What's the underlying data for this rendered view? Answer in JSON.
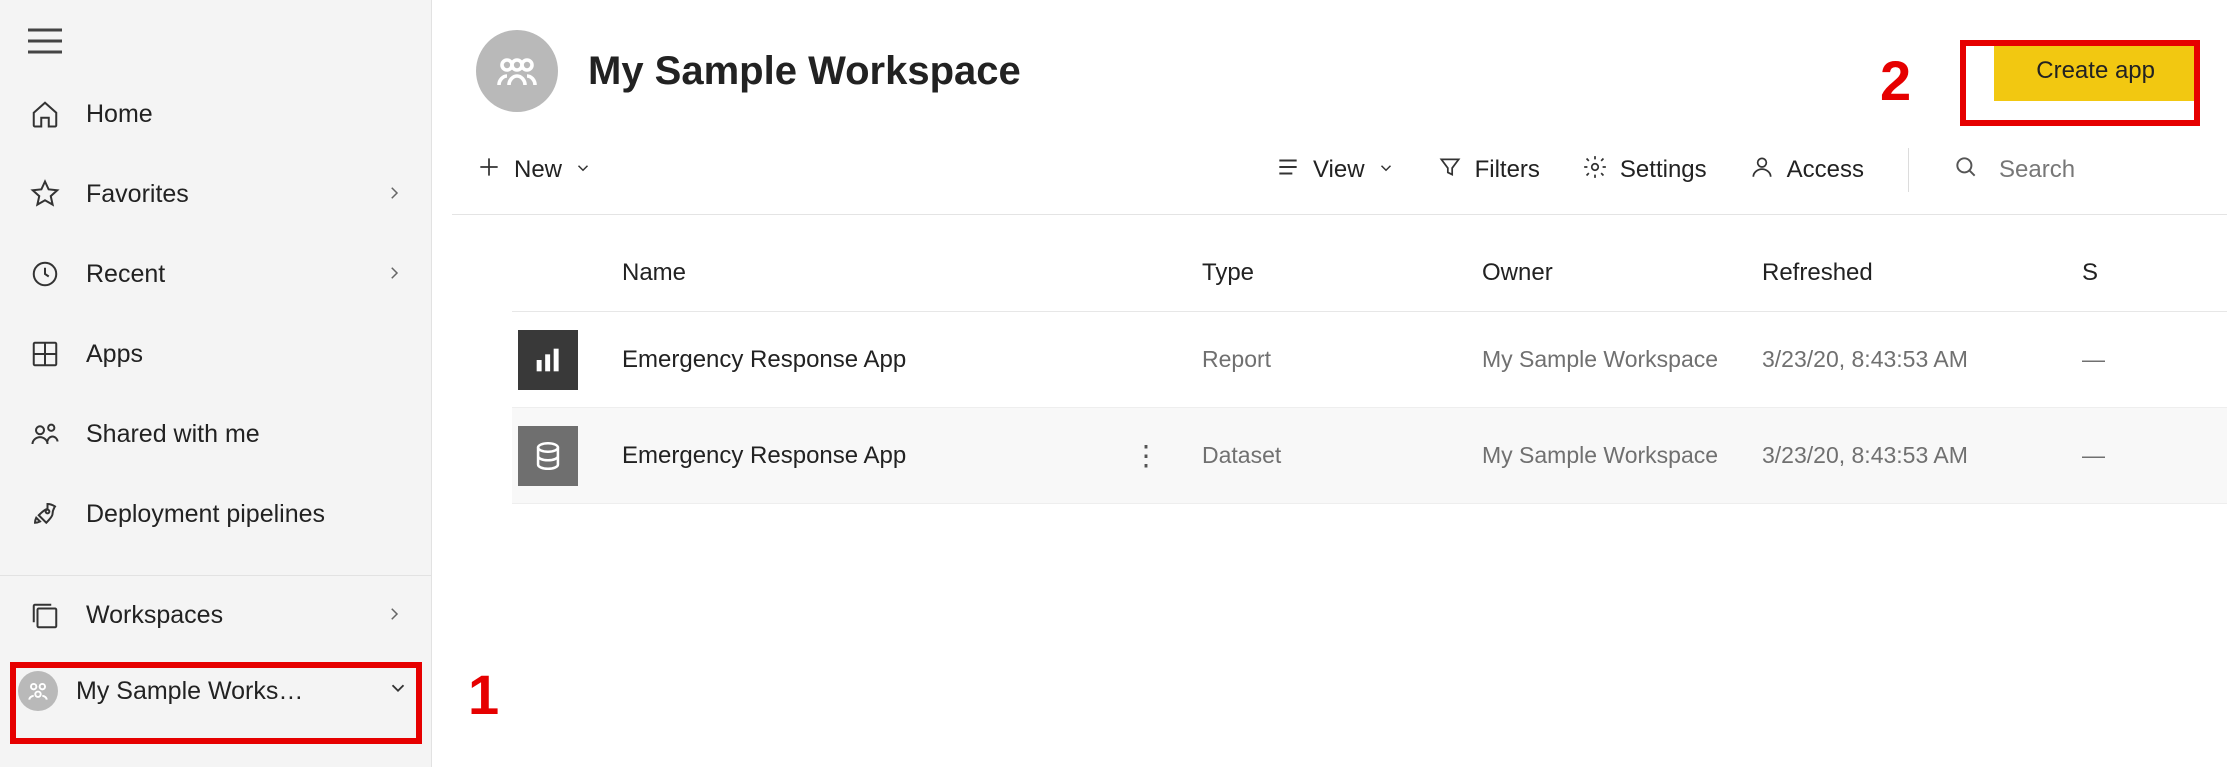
{
  "sidebar": {
    "items": [
      {
        "label": "Home"
      },
      {
        "label": "Favorites"
      },
      {
        "label": "Recent"
      },
      {
        "label": "Apps"
      },
      {
        "label": "Shared with me"
      },
      {
        "label": "Deployment pipelines"
      }
    ],
    "workspaces_label": "Workspaces",
    "current_workspace": "My Sample Works…"
  },
  "header": {
    "title": "My Sample Workspace",
    "create_app_label": "Create app"
  },
  "toolbar": {
    "new_label": "New",
    "view_label": "View",
    "filters_label": "Filters",
    "settings_label": "Settings",
    "access_label": "Access",
    "search_placeholder": "Search"
  },
  "table": {
    "columns": {
      "name": "Name",
      "type": "Type",
      "owner": "Owner",
      "refreshed": "Refreshed",
      "sensitivity": "S"
    },
    "rows": [
      {
        "name": "Emergency Response App",
        "type": "Report",
        "owner": "My Sample Workspace",
        "refreshed": "3/23/20, 8:43:53 AM",
        "sensitivity": "—"
      },
      {
        "name": "Emergency Response App",
        "type": "Dataset",
        "owner": "My Sample Workspace",
        "refreshed": "3/23/20, 8:43:53 AM",
        "sensitivity": "—"
      }
    ]
  },
  "annotations": {
    "label1": "1",
    "label2": "2"
  }
}
